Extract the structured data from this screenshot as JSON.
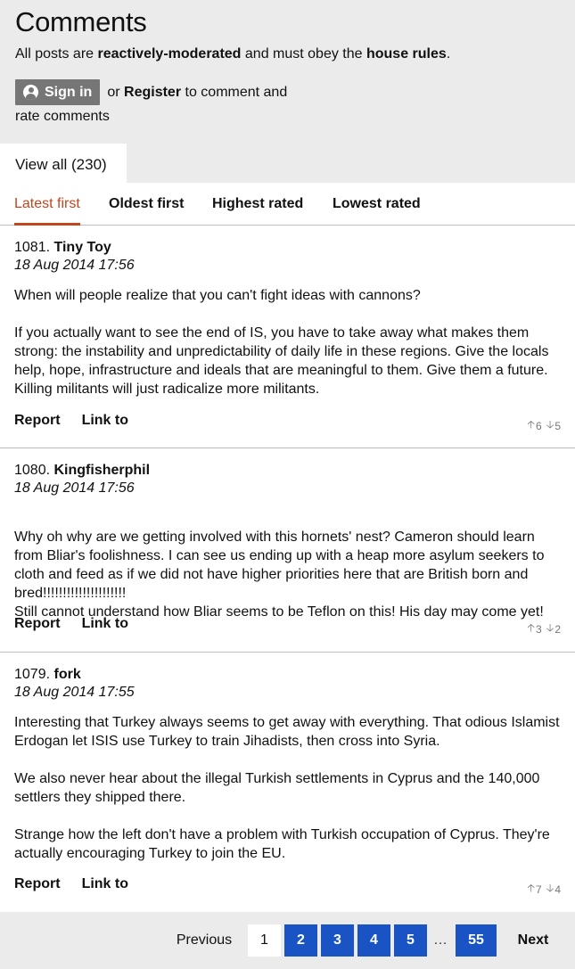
{
  "header": {
    "title": "Comments",
    "rules_prefix": "All posts are ",
    "rules_moderation": "reactively-moderated",
    "rules_middle": " and must obey the ",
    "rules_link": "house rules",
    "rules_suffix": ".",
    "signin_label": "Sign in",
    "or_text": "or",
    "register_label": "Register",
    "comment_text": "to comment and",
    "rate_text": "rate comments",
    "view_all_label": "View all (230)"
  },
  "sort_tabs": [
    {
      "label": "Latest first",
      "active": true
    },
    {
      "label": "Oldest first",
      "active": false
    },
    {
      "label": "Highest rated",
      "active": false
    },
    {
      "label": "Lowest rated",
      "active": false
    }
  ],
  "comments": [
    {
      "number": "1081.",
      "author": "Tiny Toy",
      "date": "18 Aug 2014 17:56",
      "paragraphs": [
        "When will people realize that you can't fight ideas with cannons?",
        "If you actually want to see the end of IS, you have to take away what makes them strong: the instability and unpredictability of daily life in these regions. Give the locals help, hope, infrastructure and ideals that are meaningful to them. Give them a future. Killing militants will just radicalize more militants."
      ],
      "report_label": "Report",
      "link_label": "Link to",
      "up_votes": "6",
      "down_votes": "5"
    },
    {
      "number": "1080.",
      "author": "Kingfisherphil",
      "date": "18 Aug 2014 17:56",
      "paragraphs": [
        "Why oh why are we getting involved with this hornets' nest? Cameron should learn from Bliar's foolishness. I can see us ending up with a heap more asylum seekers to cloth and feed as if we did not have higher priorities here that are British born and bred!!!!!!!!!!!!!!!!!!!!!\nStill cannot understand how Bliar seems to be Teflon on this! His day may come yet!"
      ],
      "report_label": "Report",
      "link_label": "Link to",
      "up_votes": "3",
      "down_votes": "2"
    },
    {
      "number": "1079.",
      "author": "fork",
      "date": "18 Aug 2014 17:55",
      "paragraphs": [
        "Interesting that Turkey always seems to get away with everything. That odious Islamist Erdogan let ISIS use Turkey to train Jihadists, then cross into Syria.",
        "We also never hear about the illegal Turkish settlements in Cyprus and the 140,000 settlers they shipped there.",
        "Strange how the left don't have a problem with Turkish occupation of Cyprus. They're actually encouraging Turkey to join the EU."
      ],
      "report_label": "Report",
      "link_label": "Link to",
      "up_votes": "7",
      "down_votes": "4"
    }
  ],
  "pagination": {
    "prev_label": "Previous",
    "current": "1",
    "pages": [
      "2",
      "3",
      "4",
      "5"
    ],
    "ellipsis": "…",
    "last": "55",
    "next_label": "Next"
  },
  "colors": {
    "active_tab": "#c2451f",
    "page_button": "#1a54c4",
    "header_bg": "#ebebeb",
    "signin_bg": "#767676"
  }
}
